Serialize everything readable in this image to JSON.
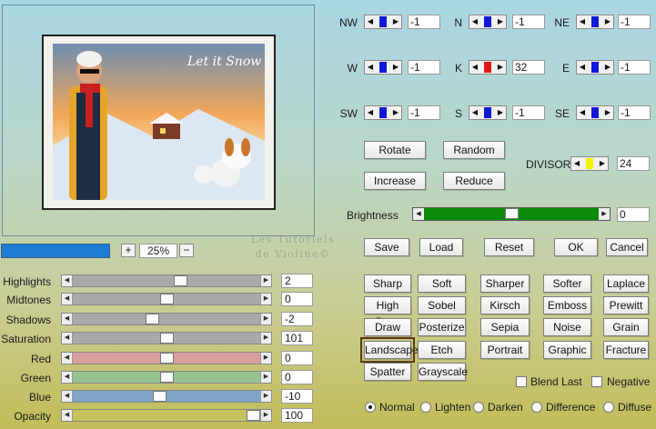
{
  "preview": {
    "image_text": "Let it Snow !",
    "zoom_minus": "−",
    "zoom_plus": "+",
    "zoom_value": "25%"
  },
  "watermark": {
    "line1": "Les Tutoriels",
    "line2": "de Violine©"
  },
  "adjustments": [
    {
      "label": "Highlights",
      "value": "2",
      "level": 0.58,
      "track_color": "#a9a9a9"
    },
    {
      "label": "Midtones",
      "value": "0",
      "level": 0.5,
      "track_color": "#a9a9a9"
    },
    {
      "label": "Shadows",
      "value": "-2",
      "level": 0.42,
      "track_color": "#a9a9a9"
    },
    {
      "label": "Saturation",
      "value": "101",
      "level": 0.5,
      "track_color": "#a9a9a9"
    },
    {
      "label": "Red",
      "value": "0",
      "level": 0.5,
      "track_color": "#d99f9f"
    },
    {
      "label": "Green",
      "value": "0",
      "level": 0.5,
      "track_color": "#95c48f"
    },
    {
      "label": "Blue",
      "value": "-10",
      "level": 0.46,
      "track_color": "#7fa6c8"
    },
    {
      "label": "Opacity",
      "value": "100",
      "level": 1.0,
      "track_color": "#c8c35c"
    }
  ],
  "matrix": [
    {
      "label": "NW",
      "value": "-1",
      "bar_color": "#1018d8"
    },
    {
      "label": "N",
      "value": "-1",
      "bar_color": "#1018d8"
    },
    {
      "label": "NE",
      "value": "-1",
      "bar_color": "#1018d8"
    },
    {
      "label": "W",
      "value": "-1",
      "bar_color": "#1018d8"
    },
    {
      "label": "K",
      "value": "32",
      "bar_color": "#e01818"
    },
    {
      "label": "E",
      "value": "-1",
      "bar_color": "#1018d8"
    },
    {
      "label": "SW",
      "value": "-1",
      "bar_color": "#1018d8"
    },
    {
      "label": "S",
      "value": "-1",
      "bar_color": "#1018d8"
    },
    {
      "label": "SE",
      "value": "-1",
      "bar_color": "#1018d8"
    }
  ],
  "matrix_buttons": {
    "rotate": "Rotate",
    "random": "Random",
    "increase": "Increase",
    "reduce": "Reduce"
  },
  "divisor": {
    "label": "DIVISOR",
    "value": "24",
    "bar_color": "#f4f400"
  },
  "brightness": {
    "label": "Brightness",
    "value": "0",
    "level": 0.5,
    "track_color": "#0a8a0a"
  },
  "actions": {
    "save": "Save",
    "load": "Load",
    "reset": "Reset",
    "ok": "OK",
    "cancel": "Cancel"
  },
  "filters": [
    [
      "Sharp",
      "Soft",
      "Sharper",
      "Softer",
      "Laplace"
    ],
    [
      "High Pass",
      "Sobel",
      "Kirsch",
      "Emboss",
      "Prewitt"
    ],
    [
      "Draw",
      "Posterize",
      "Sepia",
      "Noise",
      "Grain"
    ],
    [
      "Landscape",
      "Etch",
      "Portrait",
      "Graphic",
      "Fracture"
    ],
    [
      "Spatter",
      "Grayscale"
    ]
  ],
  "selected_filter": "Landscape",
  "options": {
    "blend_last": "Blend Last",
    "negative": "Negative"
  },
  "blend_modes": {
    "selected": "Normal",
    "items": [
      "Normal",
      "Lighten",
      "Darken",
      "Difference",
      "Diffuse"
    ]
  }
}
